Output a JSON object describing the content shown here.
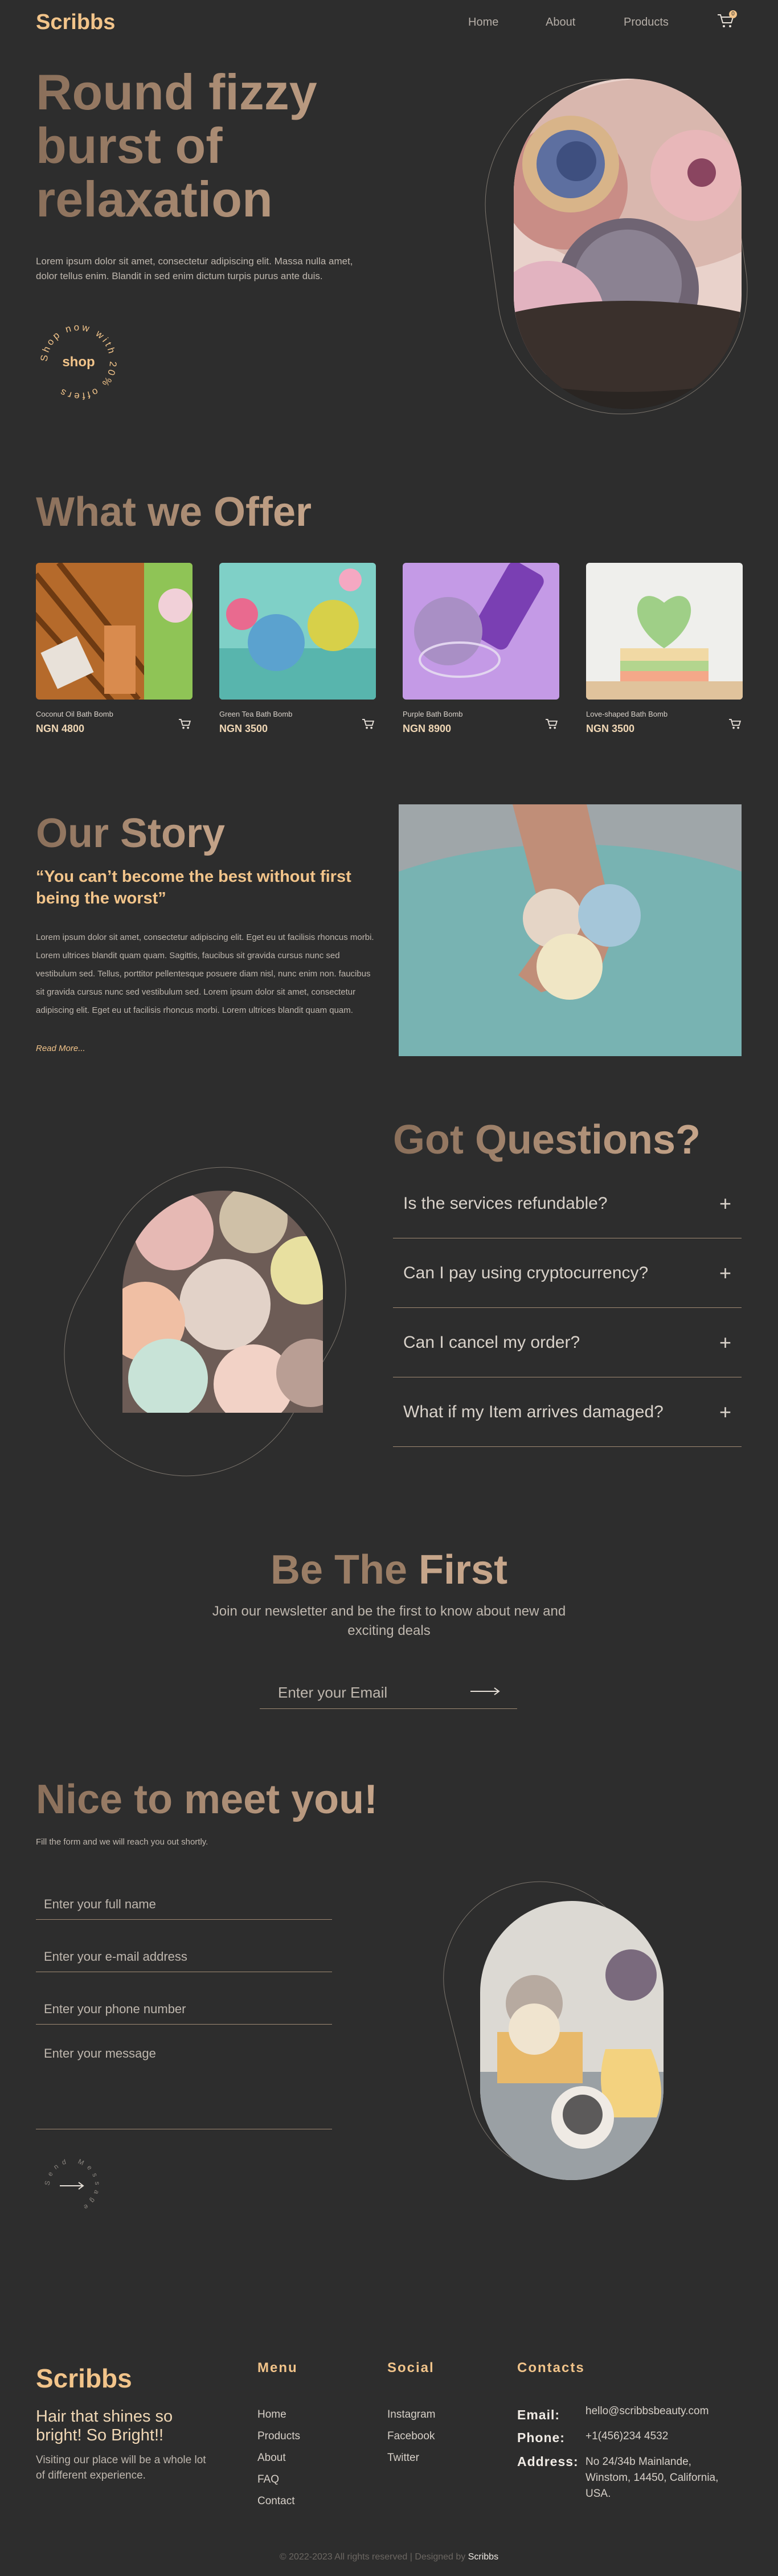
{
  "header": {
    "logo": "Scribbs",
    "nav": [
      "Home",
      "About",
      "Products"
    ],
    "cart_count": "0"
  },
  "hero": {
    "title_line1": "Round fizzy",
    "title_line2": "burst of",
    "title_line3": "relaxation",
    "description": "Lorem ipsum dolor sit amet, consectetur adipiscing elit. Massa nulla amet, dolor tellus enim. Blandit in sed enim dictum turpis purus ante duis.",
    "badge_center": "shop",
    "badge_ring": "Shop now with 20% offers"
  },
  "offer": {
    "title": "What we Offer",
    "products": [
      {
        "name": "Coconut Oil Bath Bomb",
        "price": "NGN 4800"
      },
      {
        "name": "Green Tea Bath Bomb",
        "price": "NGN 3500"
      },
      {
        "name": "Purple Bath Bomb",
        "price": "NGN 8900"
      },
      {
        "name": "Love-shaped Bath Bomb",
        "price": "NGN 3500"
      }
    ]
  },
  "story": {
    "title": "Our Story",
    "quote": "“You can’t become the best without first being the worst”",
    "body": "Lorem ipsum dolor sit amet, consectetur adipiscing elit. Eget eu ut facilisis rhoncus morbi. Lorem ultrices blandit quam quam. Sagittis, faucibus sit gravida cursus nunc sed vestibulum sed. Tellus, porttitor pellentesque posuere diam nisl, nunc enim non. faucibus sit gravida cursus nunc sed vestibulum sed. Lorem ipsum dolor sit amet, consectetur adipiscing elit. Eget eu ut facilisis rhoncus morbi. Lorem ultrices blandit quam quam.",
    "read_more": "Read More..."
  },
  "faq": {
    "title": "Got Questions?",
    "items": [
      "Is the services refundable?",
      "Can I pay using cryptocurrency?",
      "Can I cancel my order?",
      "What if my Item arrives damaged?"
    ]
  },
  "newsletter": {
    "title_part1": "Be The ",
    "title_part2": "First",
    "subtitle": "Join our newsletter and be the first to know about new and exciting deals",
    "email_placeholder": "Enter your Email"
  },
  "contact": {
    "title": "Nice to meet you!",
    "subtitle": "Fill the form and we will reach you out shortly.",
    "name_placeholder": "Enter your full name",
    "email_placeholder": "Enter your e-mail address",
    "phone_placeholder": "Enter your phone number",
    "message_placeholder": "Enter your message",
    "send_ring": "Send Message"
  },
  "footer": {
    "logo": "Scribbs",
    "tagline": "Hair that shines so bright! So Bright!!",
    "blurb": "Visiting our place will be a whole lot of different experience.",
    "menu_title": "Menu",
    "menu": [
      "Home",
      "Products",
      "About",
      "FAQ",
      "Contact"
    ],
    "social_title": "Social",
    "social": [
      "Instagram",
      "Facebook",
      "Twitter"
    ],
    "contacts_title": "Contacts",
    "email_label": "Email:",
    "email": "hello@scribbsbeauty.com",
    "phone_label": "Phone:",
    "phone": "+1(456)234 4532",
    "address_label": "Address:",
    "address": "No 24/34b Mainlande, Winstom, 14450, California, USA.",
    "copyright": "© 2022-2023 All rights reserved | Designed by",
    "designer": "Scribbs"
  },
  "colors": {
    "background": "#2d2d2d",
    "accent": "#f2c48a",
    "heading_gradient_start": "#8a6f5a",
    "heading_gradient_end": "#c6a58a"
  }
}
